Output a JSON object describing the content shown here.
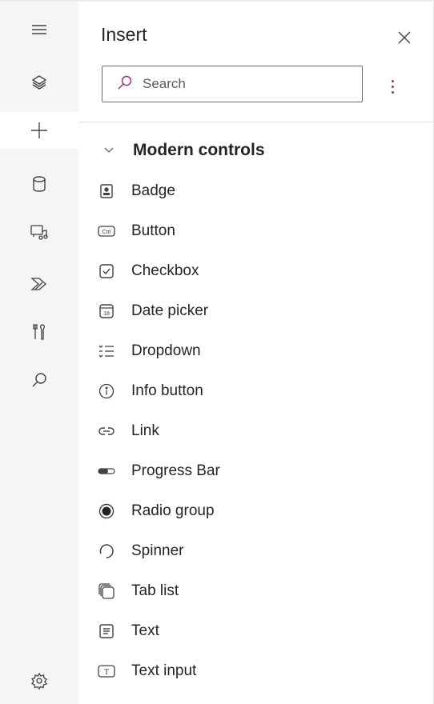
{
  "panel": {
    "title": "Insert",
    "search_placeholder": "Search",
    "section_label": "Modern controls",
    "items": [
      {
        "label": "Badge",
        "icon": "badge-icon"
      },
      {
        "label": "Button",
        "icon": "button-ctrl-icon"
      },
      {
        "label": "Checkbox",
        "icon": "checkbox-icon"
      },
      {
        "label": "Date picker",
        "icon": "calendar-icon"
      },
      {
        "label": "Dropdown",
        "icon": "dropdown-list-icon"
      },
      {
        "label": "Info button",
        "icon": "info-icon"
      },
      {
        "label": "Link",
        "icon": "link-icon"
      },
      {
        "label": "Progress Bar",
        "icon": "progress-bar-icon"
      },
      {
        "label": "Radio group",
        "icon": "radio-icon"
      },
      {
        "label": "Spinner",
        "icon": "spinner-icon"
      },
      {
        "label": "Tab list",
        "icon": "tab-list-icon"
      },
      {
        "label": "Text",
        "icon": "text-icon"
      },
      {
        "label": "Text input",
        "icon": "text-input-icon"
      }
    ]
  },
  "rail": {
    "items": [
      "hamburger-menu-icon",
      "layers-icon",
      "plus-icon",
      "database-icon",
      "media-icon",
      "power-automate-icon",
      "tools-icon",
      "search-icon",
      "settings-icon"
    ],
    "active": "plus-icon"
  },
  "colors": {
    "accent": "#9b2d8e",
    "rail_bg": "#f5f5f5",
    "text": "#242424"
  }
}
